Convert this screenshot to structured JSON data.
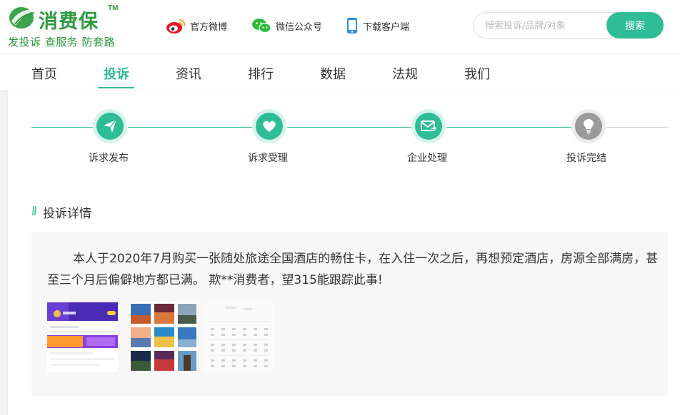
{
  "header": {
    "logo": {
      "name": "消费保",
      "tm": "TM",
      "slogan": "发投诉 查服务 防套路"
    },
    "links": [
      {
        "label": "官方微博",
        "icon": "weibo-icon"
      },
      {
        "label": "微信公众号",
        "icon": "wechat-icon"
      },
      {
        "label": "下载客户端",
        "icon": "phone-icon"
      }
    ],
    "search": {
      "placeholder": "搜索投诉/品牌/对象",
      "value": "",
      "button_label": "搜索"
    }
  },
  "nav": {
    "items": [
      "首页",
      "投诉",
      "资讯",
      "排行",
      "数据",
      "法规",
      "我们"
    ],
    "active": "投诉"
  },
  "steps": [
    {
      "label": "诉求发布",
      "icon": "paper-plane-icon",
      "state": "done"
    },
    {
      "label": "诉求受理",
      "icon": "heart-icon",
      "state": "done"
    },
    {
      "label": "企业处理",
      "icon": "envelope-icon",
      "state": "done"
    },
    {
      "label": "投诉完结",
      "icon": "lightbulb-icon",
      "state": "pending"
    }
  ],
  "detail": {
    "section_title": "投诉详情",
    "text": "本人于2020年7月购买一张随处旅途全国酒店的畅住卡，在入住一次之后，再想预定酒店，房源全部满房，甚至三个月后偏僻地方都已满。 欺**消费者，望315能跟踪此事!",
    "images": [
      {
        "name": "attachment-image-1"
      },
      {
        "name": "attachment-image-2"
      },
      {
        "name": "attachment-image-3"
      }
    ]
  },
  "colors": {
    "accent": "#2ebd95",
    "brand": "#2e9a3f",
    "pending": "#9a9a9a",
    "panel_bg": "#f7f7f7"
  }
}
